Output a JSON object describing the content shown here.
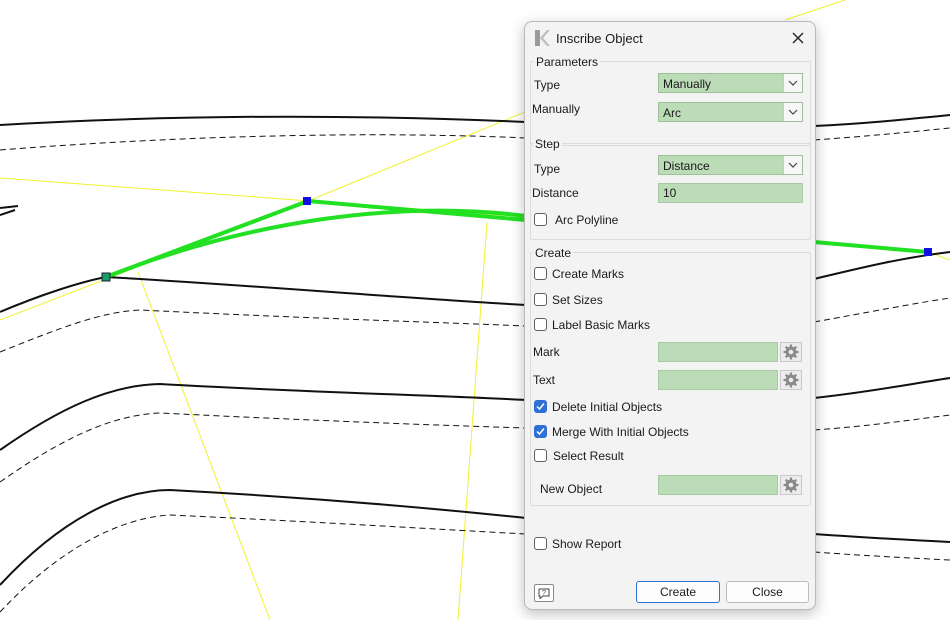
{
  "dialog": {
    "title": "Inscribe Object",
    "title_icon": "k-logo-icon",
    "close_icon": "close-icon",
    "parameters": {
      "legend": "Parameters",
      "type_label": "Type",
      "type_value": "Manually",
      "manually_label": "Manually",
      "manually_value": "Arc"
    },
    "step": {
      "legend": "Step",
      "type_label": "Type",
      "type_value": "Distance",
      "distance_label": "Distance",
      "distance_value": "10",
      "arc_polyline_label": "Arc Polyline",
      "arc_polyline_checked": false
    },
    "create": {
      "legend": "Create",
      "create_marks_label": "Create Marks",
      "create_marks_checked": false,
      "set_sizes_label": "Set Sizes",
      "set_sizes_checked": false,
      "label_basic_marks_label": "Label Basic Marks",
      "label_basic_marks_checked": false,
      "mark_label": "Mark",
      "mark_value": "",
      "text_label": "Text",
      "text_value": "",
      "delete_initial_label": "Delete Initial Objects",
      "delete_initial_checked": true,
      "merge_initial_label": "Merge With Initial Objects",
      "merge_initial_checked": true,
      "select_result_label": "Select Result",
      "select_result_checked": false,
      "new_object_label": "New Object",
      "new_object_value": ""
    },
    "show_report_label": "Show Report",
    "show_report_checked": false,
    "help_icon": "help-icon",
    "create_button": "Create",
    "close_button": "Close"
  },
  "colors": {
    "accent": "#2f6fd6",
    "field_fill": "#bcdcb8",
    "highlight_line": "#22e022",
    "guide_line": "#f2f230",
    "vertex_marker": "#1010e0"
  }
}
